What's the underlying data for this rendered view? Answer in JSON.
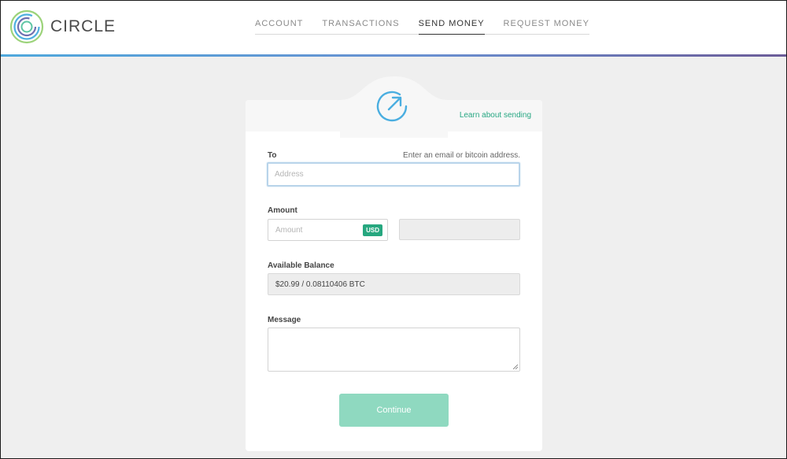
{
  "brand": {
    "name": "CIRCLE",
    "logo_icon": "circle-rings-logo"
  },
  "nav": {
    "items": [
      {
        "label": "ACCOUNT",
        "active": false
      },
      {
        "label": "TRANSACTIONS",
        "active": false
      },
      {
        "label": "SEND MONEY",
        "active": true
      },
      {
        "label": "REQUEST MONEY",
        "active": false
      }
    ]
  },
  "card": {
    "icon": "send-arrow-icon",
    "learn_link": "Learn about sending",
    "to": {
      "label": "To",
      "hint": "Enter an email or bitcoin address.",
      "placeholder": "Address"
    },
    "amount": {
      "label": "Amount",
      "placeholder": "Amount",
      "currency": "USD",
      "converted_value": ""
    },
    "balance": {
      "label": "Available Balance",
      "value": "$20.99 / 0.08110406 BTC"
    },
    "message": {
      "label": "Message",
      "value": ""
    },
    "continue_label": "Continue"
  },
  "colors": {
    "accent_green": "#26a77f",
    "button_disabled": "#8fd9c0",
    "icon_blue": "#4aaee0",
    "bar_start": "#4fa8dc",
    "bar_end": "#6b5c98"
  }
}
